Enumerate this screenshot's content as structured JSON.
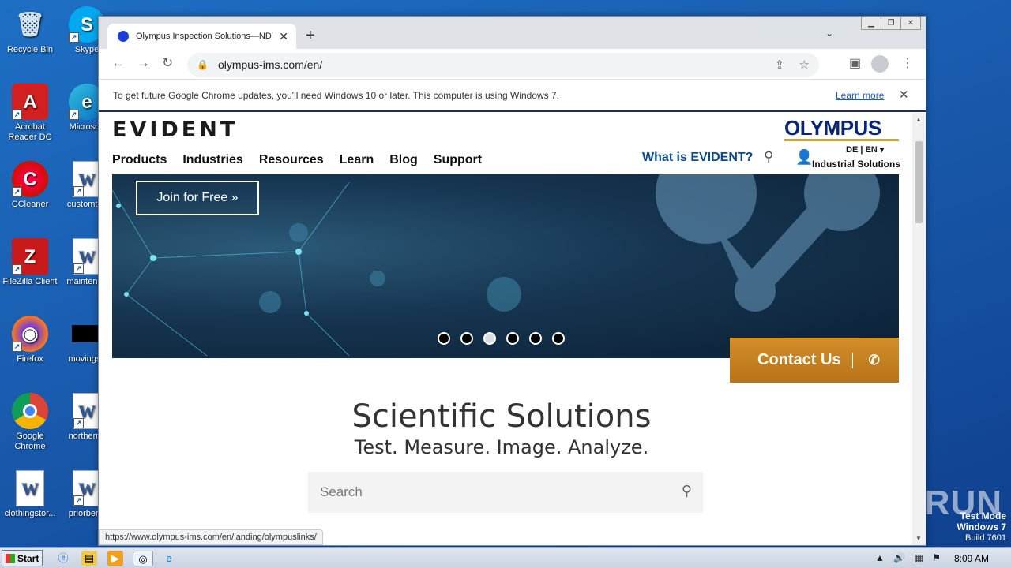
{
  "desktop": {
    "icons": [
      {
        "label": "Recycle Bin",
        "glyph": "🗑"
      },
      {
        "label": "Skype",
        "glyph": "S"
      },
      {
        "label": "Acrobat Reader DC",
        "glyph": "A"
      },
      {
        "label": "Microsoft",
        "glyph": "e"
      },
      {
        "label": "CCleaner",
        "glyph": "C"
      },
      {
        "label": "customtes",
        "glyph": "W"
      },
      {
        "label": "FileZilla Client",
        "glyph": "Z"
      },
      {
        "label": "maintenan",
        "glyph": "W"
      },
      {
        "label": "Firefox",
        "glyph": "◉"
      },
      {
        "label": "movingsu",
        "glyph": ""
      },
      {
        "label": "Google Chrome",
        "glyph": "◎"
      },
      {
        "label": "northernb",
        "glyph": "W"
      },
      {
        "label": "clothingstor...",
        "glyph": "W"
      },
      {
        "label": "priorbene",
        "glyph": "W"
      }
    ]
  },
  "browser": {
    "tab_title": "Olympus Inspection Solutions—NDT,",
    "url": "olympus-ims.com/en/",
    "infobar_message": "To get future Google Chrome updates, you'll need Windows 10 or later. This computer is using Windows 7.",
    "infobar_link": "Learn more",
    "status_url": "https://www.olympus-ims.com/en/landing/olympuslinks/"
  },
  "site": {
    "logo_left": "EVIDENT",
    "logo_right": "OLYMPUS",
    "lang": "DE  |  EN ▾",
    "account_label": "Industrial Solutions",
    "nav": [
      "Products",
      "Industries",
      "Resources",
      "Learn",
      "Blog",
      "Support"
    ],
    "what_is": "What is EVIDENT?",
    "hero": {
      "join_label": "Join for Free »",
      "slide_count": 6,
      "active_slide": 3
    },
    "contact_label": "Contact Us",
    "headline": "Scientific Solutions",
    "subheadline": "Test. Measure. Image. Analyze.",
    "search_placeholder": "Search"
  },
  "watermark": {
    "brand": "ANY▷RUN",
    "line1": "Test Mode",
    "line2": "Windows 7",
    "line3": "Build 7601"
  },
  "taskbar": {
    "start_label": "Start",
    "clock": "8:09 AM"
  },
  "colors": {
    "evident_blue": "#0b4a8a",
    "olympus_navy": "#08237a",
    "contact_orange": "#c98421",
    "desktop_blue": "#1a5db0"
  }
}
